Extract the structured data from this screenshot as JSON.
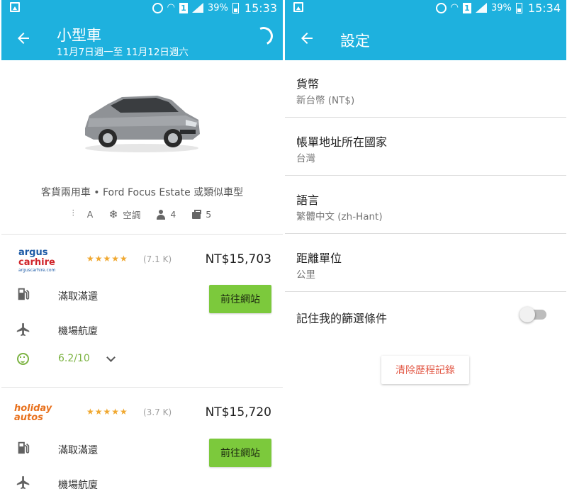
{
  "status_left": {
    "battery_pct": "39%",
    "time": "15:33",
    "sim": "1"
  },
  "status_right": {
    "battery_pct": "39%",
    "time": "15:34",
    "sim": "1"
  },
  "left": {
    "title": "小型車",
    "subtitle": "11月7日週一至 11月12日週六",
    "car_desc": "客貨兩用車 • Ford Focus Estate 或類似車型",
    "specs": {
      "transmission": "A",
      "ac": "空調",
      "seats": "4",
      "bags": "5"
    },
    "offers": [
      {
        "logo_line1": "argus",
        "logo_line2": "carhire",
        "logo_line3": "arguscarhire.com",
        "stars": "★★★★★",
        "reviews": "(7.1 K)",
        "price": "NT$15,703",
        "fuel": "滿取滿還",
        "pickup": "機場航廈",
        "button": "前往網站",
        "score": "6.2/10"
      },
      {
        "logo_line1": "holiday",
        "logo_line2": "autos",
        "stars": "★★★★★",
        "reviews": "(3.7 K)",
        "price": "NT$15,720",
        "fuel": "滿取滿還",
        "pickup": "機場航廈",
        "button": "前往網站"
      }
    ]
  },
  "right": {
    "title": "設定",
    "settings": [
      {
        "title": "貨幣",
        "value": "新台幣 (NT$)"
      },
      {
        "title": "帳單地址所在國家",
        "value": "台灣"
      },
      {
        "title": "語言",
        "value": "繁體中文 (zh-Hant)"
      },
      {
        "title": "距離單位",
        "value": "公里"
      }
    ],
    "remember_filters": {
      "label": "記住我的篩選條件",
      "enabled": false
    },
    "clear_history": "清除歷程記錄"
  },
  "colors": {
    "appbar": "#1eb1de",
    "go_button": "#7cc93c",
    "score": "#7cb342",
    "clear_text": "#e35d4b",
    "stars": "#f0a830"
  }
}
